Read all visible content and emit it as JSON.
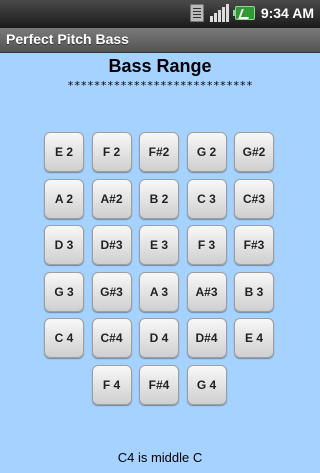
{
  "status_bar": {
    "time": "9:34",
    "time_suffix": "AM"
  },
  "app": {
    "title": "Perfect Pitch Bass"
  },
  "screen": {
    "heading": "Bass Range",
    "stars": "****************************",
    "note": "C4 is middle C"
  },
  "keys": [
    [
      "E 2",
      "F 2",
      "F#2",
      "G 2",
      "G#2"
    ],
    [
      "A 2",
      "A#2",
      "B 2",
      "C 3",
      "C#3"
    ],
    [
      "D 3",
      "D#3",
      "E 3",
      "F 3",
      "F#3"
    ],
    [
      "G 3",
      "G#3",
      "A 3",
      "A#3",
      "B 3"
    ],
    [
      "C 4",
      "C#4",
      "D 4",
      "D#4",
      "E 4"
    ],
    [
      "F 4",
      "F#4",
      "G 4"
    ]
  ]
}
